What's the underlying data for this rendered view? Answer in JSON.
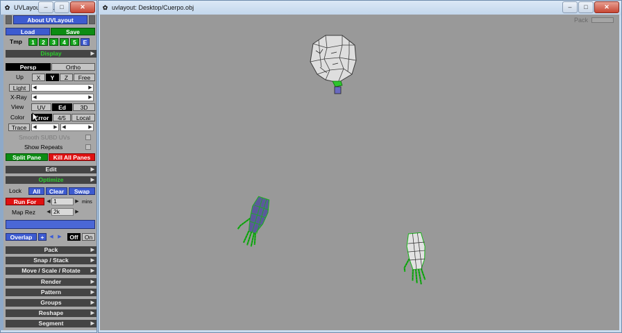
{
  "left_window": {
    "title": "UVLayout: C...",
    "about_label": "About UVLayout",
    "load_label": "Load",
    "save_label": "Save",
    "tmp_label": "Tmp",
    "tmp_slots": [
      "1",
      "2",
      "3",
      "4",
      "5",
      "E"
    ],
    "display_header": "Display",
    "persp_label": "Persp",
    "ortho_label": "Ortho",
    "up_label": "Up",
    "up_axes": [
      "X",
      "Y",
      "Z",
      "Free"
    ],
    "light_label": "Light",
    "xray_label": "X-Ray",
    "view_label": "View",
    "view_modes": [
      "UV",
      "Ed",
      "3D"
    ],
    "color_label": "Color",
    "color_modes": [
      "Error",
      "4/5",
      "Local"
    ],
    "trace_label": "Trace",
    "smooth_label": "Smooth SUBD UVs",
    "show_repeats_label": "Show Repeats",
    "split_pane_label": "Split Pane",
    "kill_panes_label": "Kill All Panes",
    "edit_header": "Edit",
    "optimize_header": "Optimize",
    "lock_label": "Lock",
    "lock_buttons": [
      "All",
      "Clear",
      "Swap"
    ],
    "run_for_label": "Run For",
    "run_for_value": "1",
    "mins_label": "mins",
    "map_rez_label": "Map Rez",
    "map_rez_value": "2k",
    "overlap_label": "Overlap",
    "overlap_plus": "+",
    "off_label": "Off",
    "on_label": "On",
    "menu_headers": [
      "Pack",
      "Snap / Stack",
      "Move / Scale / Rotate",
      "Render",
      "Pattern",
      "Groups",
      "Reshape",
      "Segment"
    ]
  },
  "right_window": {
    "title": "uvlayout: Desktop/Cuerpo.obj",
    "pack_label": "Pack"
  },
  "colors": {
    "viewport_bg": "#999999",
    "panel_bg": "#a7a7a7",
    "header_bg": "#444444",
    "accent_blue": "#3d5bd0",
    "accent_green": "#0c8c13",
    "accent_red": "#e01010",
    "mesh_green": "#18b418"
  }
}
